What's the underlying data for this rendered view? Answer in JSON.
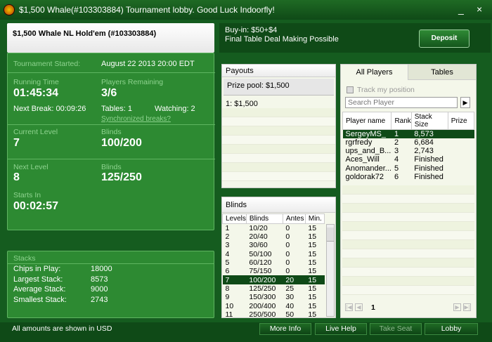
{
  "window": {
    "title": "$1,500 Whale(#103303884) Tournament lobby. Good Luck Indoorfly!",
    "minimize": "_",
    "close": "×"
  },
  "header": {
    "tournament_name": "$1,500 Whale NL Hold'em (#103303884)",
    "buyin": "Buy-in: $50+$4",
    "deal": "Final Table Deal Making Possible",
    "deposit_label": "Deposit"
  },
  "info": {
    "started_label": "Tournament Started:",
    "started_value": "August 22 2013  20:00 EDT",
    "running_label": "Running Time",
    "running_value": "01:45:34",
    "remaining_label": "Players Remaining",
    "remaining_value": "3/6",
    "next_break": "Next Break: 00:09:26",
    "tables": "Tables: 1",
    "watching": "Watching: 2",
    "sync_breaks": "Synchronized breaks?",
    "current_level_label": "Current Level",
    "current_level_value": "7",
    "blinds_label": "Blinds",
    "current_blinds": "100/200",
    "next_level_label": "Next Level",
    "next_level_value": "8",
    "next_blinds": "125/250",
    "starts_in_label": "Starts In",
    "starts_in_value": "00:02:57"
  },
  "stacks": {
    "title": "Stacks",
    "rows": [
      {
        "label": "Chips in Play:",
        "value": "18000"
      },
      {
        "label": "Largest Stack:",
        "value": "8573"
      },
      {
        "label": "Average Stack:",
        "value": "9000"
      },
      {
        "label": "Smallest Stack:",
        "value": "2743"
      }
    ]
  },
  "payouts": {
    "title": "Payouts",
    "prize_pool": "Prize pool: $1,500",
    "entries": [
      "1: $1,500"
    ]
  },
  "blinds": {
    "title": "Blinds",
    "headers": [
      "Levels",
      "Blinds",
      "Antes",
      "Min."
    ],
    "rows": [
      [
        "1",
        "10/20",
        "0",
        "15"
      ],
      [
        "2",
        "20/40",
        "0",
        "15"
      ],
      [
        "3",
        "30/60",
        "0",
        "15"
      ],
      [
        "4",
        "50/100",
        "0",
        "15"
      ],
      [
        "5",
        "60/120",
        "0",
        "15"
      ],
      [
        "6",
        "75/150",
        "0",
        "15"
      ],
      [
        "7",
        "100/200",
        "20",
        "15"
      ],
      [
        "8",
        "125/250",
        "25",
        "15"
      ],
      [
        "9",
        "150/300",
        "30",
        "15"
      ],
      [
        "10",
        "200/400",
        "40",
        "15"
      ],
      [
        "11",
        "250/500",
        "50",
        "15"
      ]
    ],
    "highlight_index": 6
  },
  "players": {
    "tab_all": "All Players",
    "tab_tables": "Tables",
    "track_label": "Track my position",
    "search_placeholder": "Search Player",
    "headers": [
      "Player name",
      "Rank",
      "Stack Size",
      "Prize"
    ],
    "rows": [
      [
        "SergeyMS_",
        "1",
        "8,573",
        ""
      ],
      [
        "rgrfredy",
        "2",
        "6,684",
        ""
      ],
      [
        "ups_and_B...",
        "3",
        "2,743",
        ""
      ],
      [
        "Aces_Will",
        "4",
        "Finished",
        ""
      ],
      [
        "Anomander...",
        "5",
        "Finished",
        ""
      ],
      [
        "goldorak72",
        "6",
        "Finished",
        ""
      ]
    ],
    "page": "1"
  },
  "footer": {
    "note": "All amounts are shown in USD",
    "more_info": "More Info",
    "live_help": "Live Help",
    "take_seat": "Take Seat",
    "lobby": "Lobby"
  },
  "colors": {
    "accent": "#2d8a32",
    "highlight_row": "#0f4a17"
  }
}
